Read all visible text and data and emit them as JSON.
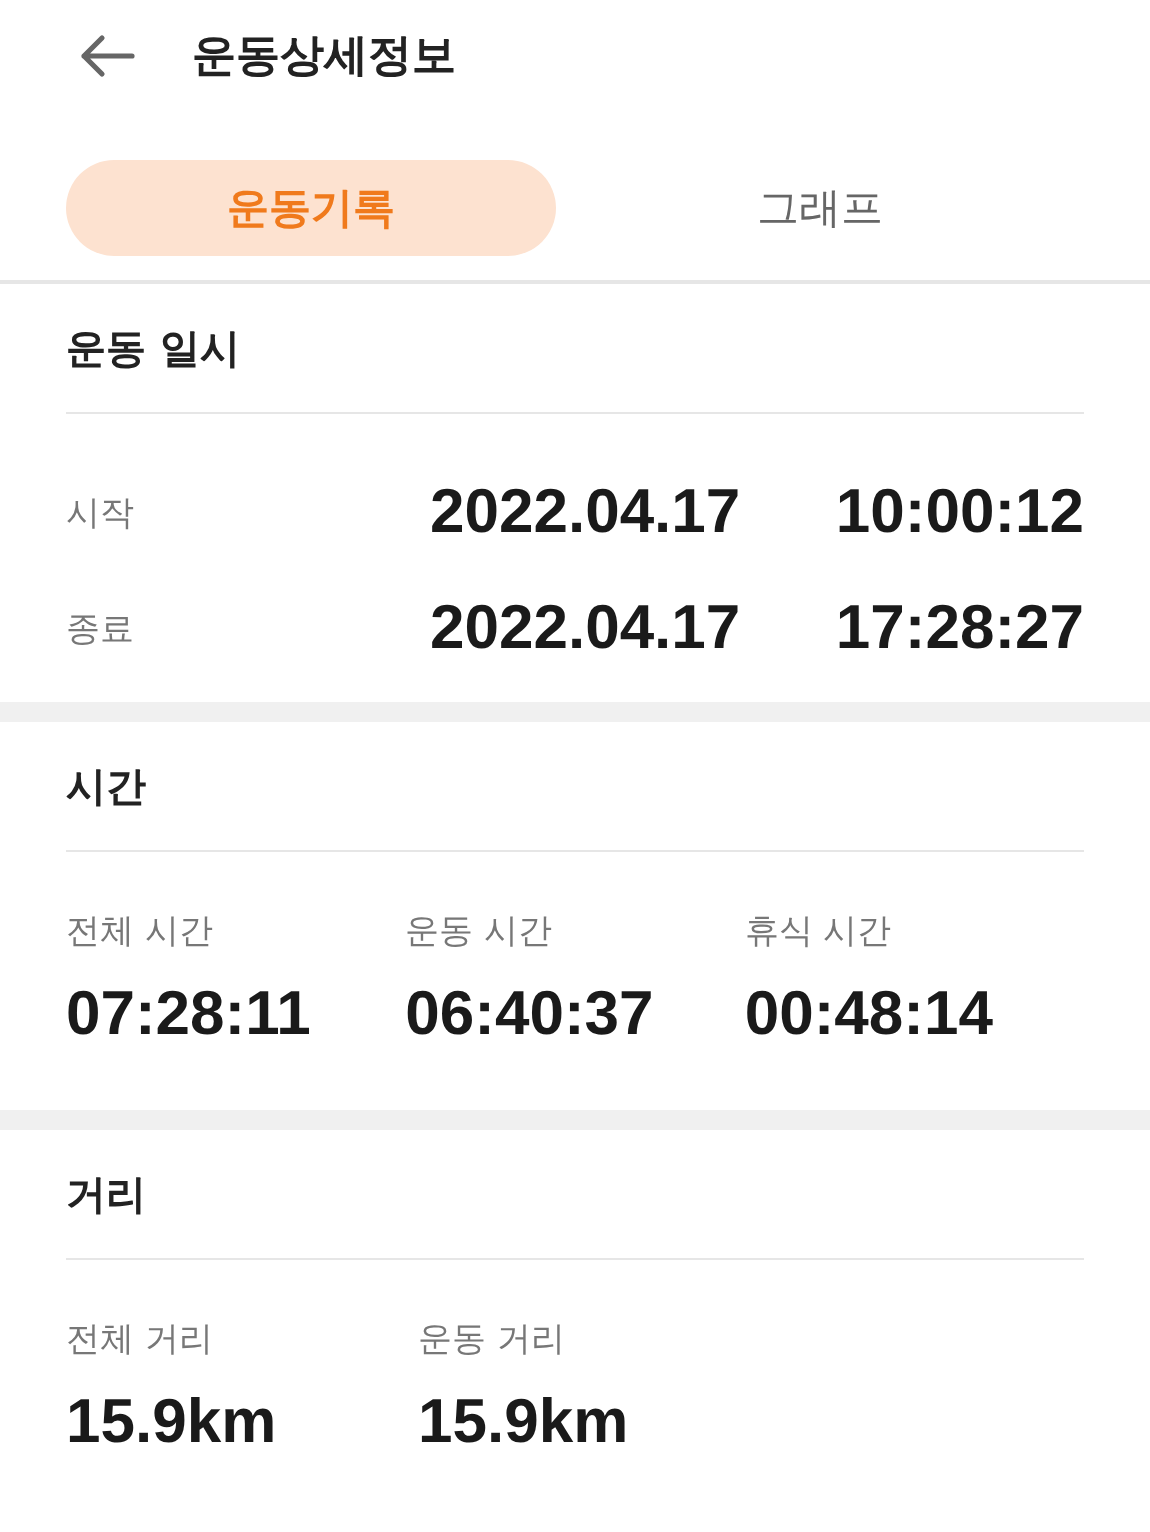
{
  "header": {
    "title": "운동상세정보"
  },
  "tabs": [
    {
      "label": "운동기록",
      "selected": true
    },
    {
      "label": "그래프",
      "selected": false
    }
  ],
  "sections": [
    {
      "kind": "datetime",
      "title": "운동 일시",
      "rows": [
        {
          "label": "시작",
          "date": "2022.04.17",
          "time": "10:00:12"
        },
        {
          "label": "종료",
          "date": "2022.04.17",
          "time": "17:28:27"
        }
      ]
    },
    {
      "kind": "stats",
      "title": "시간",
      "stats": [
        {
          "label": "전체 시간",
          "value": "07:28:11"
        },
        {
          "label": "운동 시간",
          "value": "06:40:37"
        },
        {
          "label": "휴식 시간",
          "value": "00:48:14"
        }
      ]
    },
    {
      "kind": "stats",
      "title": "거리",
      "stats": [
        {
          "label": "전체 거리",
          "value": "15.9km"
        },
        {
          "label": "운동 거리",
          "value": "15.9km"
        }
      ]
    }
  ]
}
